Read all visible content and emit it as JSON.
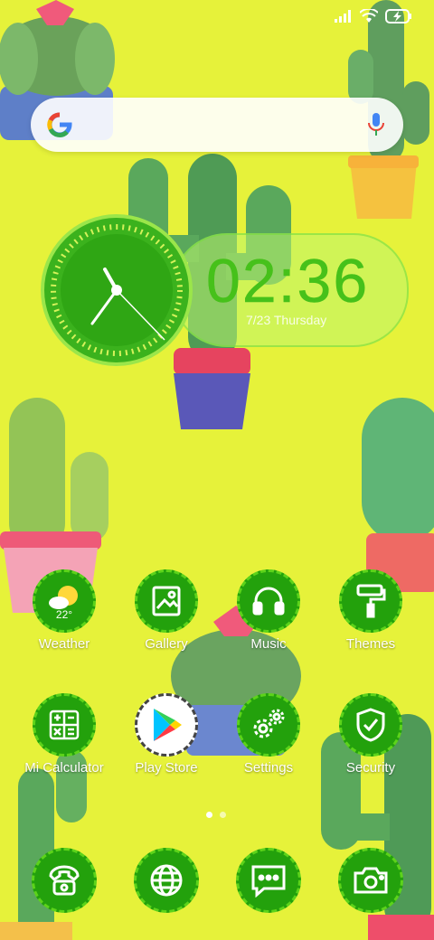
{
  "colors": {
    "background": "#e6f23a",
    "icon_green": "#23a10c",
    "clock_green": "#46c11a"
  },
  "status_bar": {
    "icons": [
      "signal-icon",
      "wifi-icon",
      "battery-charging-icon"
    ]
  },
  "search": {
    "icon": "google-logo-icon",
    "voice_icon": "microphone-icon"
  },
  "clock": {
    "time": "02:36",
    "date": "7/23 Thursday"
  },
  "weather": {
    "temp": "22°"
  },
  "apps_row1": [
    {
      "label": "Weather",
      "icon": "weather-icon"
    },
    {
      "label": "Gallery",
      "icon": "gallery-icon"
    },
    {
      "label": "Music",
      "icon": "headphones-icon"
    },
    {
      "label": "Themes",
      "icon": "paint-roller-icon"
    }
  ],
  "apps_row2": [
    {
      "label": "Mi Calculator",
      "icon": "calculator-icon"
    },
    {
      "label": "Play Store",
      "icon": "play-store-icon"
    },
    {
      "label": "Settings",
      "icon": "gear-icon"
    },
    {
      "label": "Security",
      "icon": "shield-check-icon"
    }
  ],
  "dock": [
    {
      "icon": "phone-icon"
    },
    {
      "icon": "browser-globe-icon"
    },
    {
      "icon": "messages-icon"
    },
    {
      "icon": "camera-icon"
    }
  ],
  "page_indicator": {
    "pages": 2,
    "current": 1
  }
}
